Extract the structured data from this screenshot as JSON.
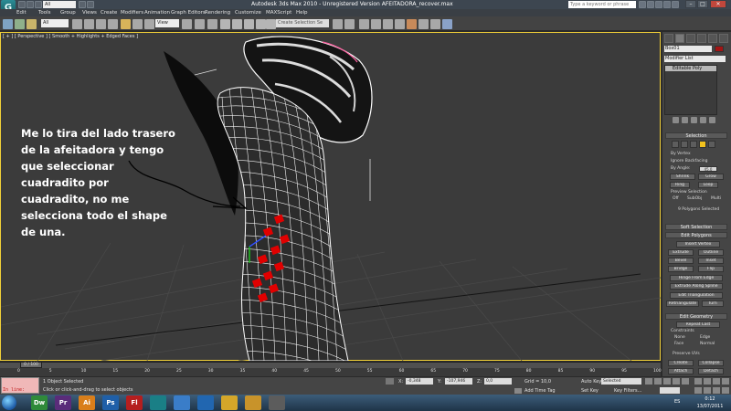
{
  "titlebar": {
    "workspace": "All",
    "title": "Autodesk 3ds Max 2010    -  Unregistered Version      AFEITADORA_recover.max",
    "search_placeholder": "Type a keyword or phrase"
  },
  "menu": [
    "Edit",
    "Tools",
    "Group",
    "Views",
    "Create",
    "Modifiers",
    "Animation",
    "Graph Editors",
    "Rendering",
    "Customize",
    "MAXScript",
    "Help"
  ],
  "toolbar": {
    "all_filter": "All",
    "reference_coord": "View",
    "selection_set_placeholder": "Create Selection Se"
  },
  "viewport": {
    "label": "[ + ] [ Perspective ] [ Smooth + Highlights + Edged Faces ]",
    "annotation": "Me lo tira del lado trasero de la afeitadora y tengo que seleccionar cuadradito por cuadradito, no me selecciona todo el shape de una."
  },
  "command_panel": {
    "object_name": "Box01",
    "modifier_list": "Modifier List",
    "stack_item": "Editable Poly",
    "selection": {
      "title": "Selection",
      "by_vertex": "By Vertex",
      "ignore_backfacing": "Ignore Backfacing",
      "by_angle": "By Angle:",
      "by_angle_value": "45.0",
      "shrink": "Shrink",
      "grow": "Grow",
      "ring": "Ring",
      "loop": "Loop",
      "preview_selection": "Preview Selection",
      "preview_options": [
        "Off",
        "SubObj",
        "Multi"
      ],
      "status": "9 Polygons Selected"
    },
    "soft_selection": "Soft Selection",
    "edit_polygons": {
      "title": "Edit Polygons",
      "insert_vertex": "Insert Vertex",
      "extrude": "Extrude",
      "outline": "Outline",
      "bevel": "Bevel",
      "inset": "Inset",
      "bridge": "Bridge",
      "flip": "Flip",
      "hinge": "Hinge From Edge",
      "extrude_spline": "Extrude Along Spline",
      "edit_triangulation": "Edit Triangulation",
      "retriangulate": "Retriangulate",
      "turn": "Turn"
    },
    "edit_geometry": {
      "title": "Edit Geometry",
      "repeat_last": "Repeat Last",
      "constraints": "Constraints",
      "constraint_options": [
        "None",
        "Edge",
        "Face",
        "Normal"
      ],
      "preserve_uvs": "Preserve UVs",
      "create": "Create",
      "collapse": "Collapse",
      "attach": "Attach",
      "detach": "Detach"
    }
  },
  "timeline": {
    "frame": "0 / 100",
    "ticks": [
      "0",
      "5",
      "10",
      "15",
      "20",
      "25",
      "30",
      "35",
      "40",
      "45",
      "50",
      "55",
      "60",
      "65",
      "70",
      "75",
      "80",
      "85",
      "90",
      "95",
      "100"
    ]
  },
  "status": {
    "listener": "In line:",
    "selected": "1 Object Selected",
    "prompt": "Click or click-and-drag to select objects",
    "x_label": "X:",
    "x_value": "-0,348",
    "y_label": "Y:",
    "y_value": "-107,946",
    "z_label": "Z:",
    "z_value": "0,0",
    "grid": "Grid = 10,0",
    "add_time_tag": "Add Time Tag",
    "auto_key": "Auto Key",
    "set_key": "Set Key",
    "key_mode": "Selected",
    "key_filters": "Key Filters..."
  },
  "taskbar": {
    "apps": [
      {
        "label": "Dw",
        "color": "#2f8a3a"
      },
      {
        "label": "Pr",
        "color": "#5a2c7a"
      },
      {
        "label": "Ai",
        "color": "#d97e1a"
      },
      {
        "label": "Ps",
        "color": "#1f5fa8"
      },
      {
        "label": "Fl",
        "color": "#b51e1e"
      },
      {
        "label": "",
        "color": "#1a7f86"
      },
      {
        "label": "",
        "color": "#3a7dc8"
      },
      {
        "label": "",
        "color": "#2166b0"
      },
      {
        "label": "",
        "color": "#d4a629"
      },
      {
        "label": "",
        "color": "#c8932a"
      },
      {
        "label": "",
        "color": "#5c5c5c"
      }
    ],
    "language": "ES",
    "time": "0:12",
    "date": "13/07/2011"
  },
  "colors": {
    "viewport_border": "#f1d038",
    "selected_faces": "#e00000",
    "wireframe": "#ffffff"
  }
}
